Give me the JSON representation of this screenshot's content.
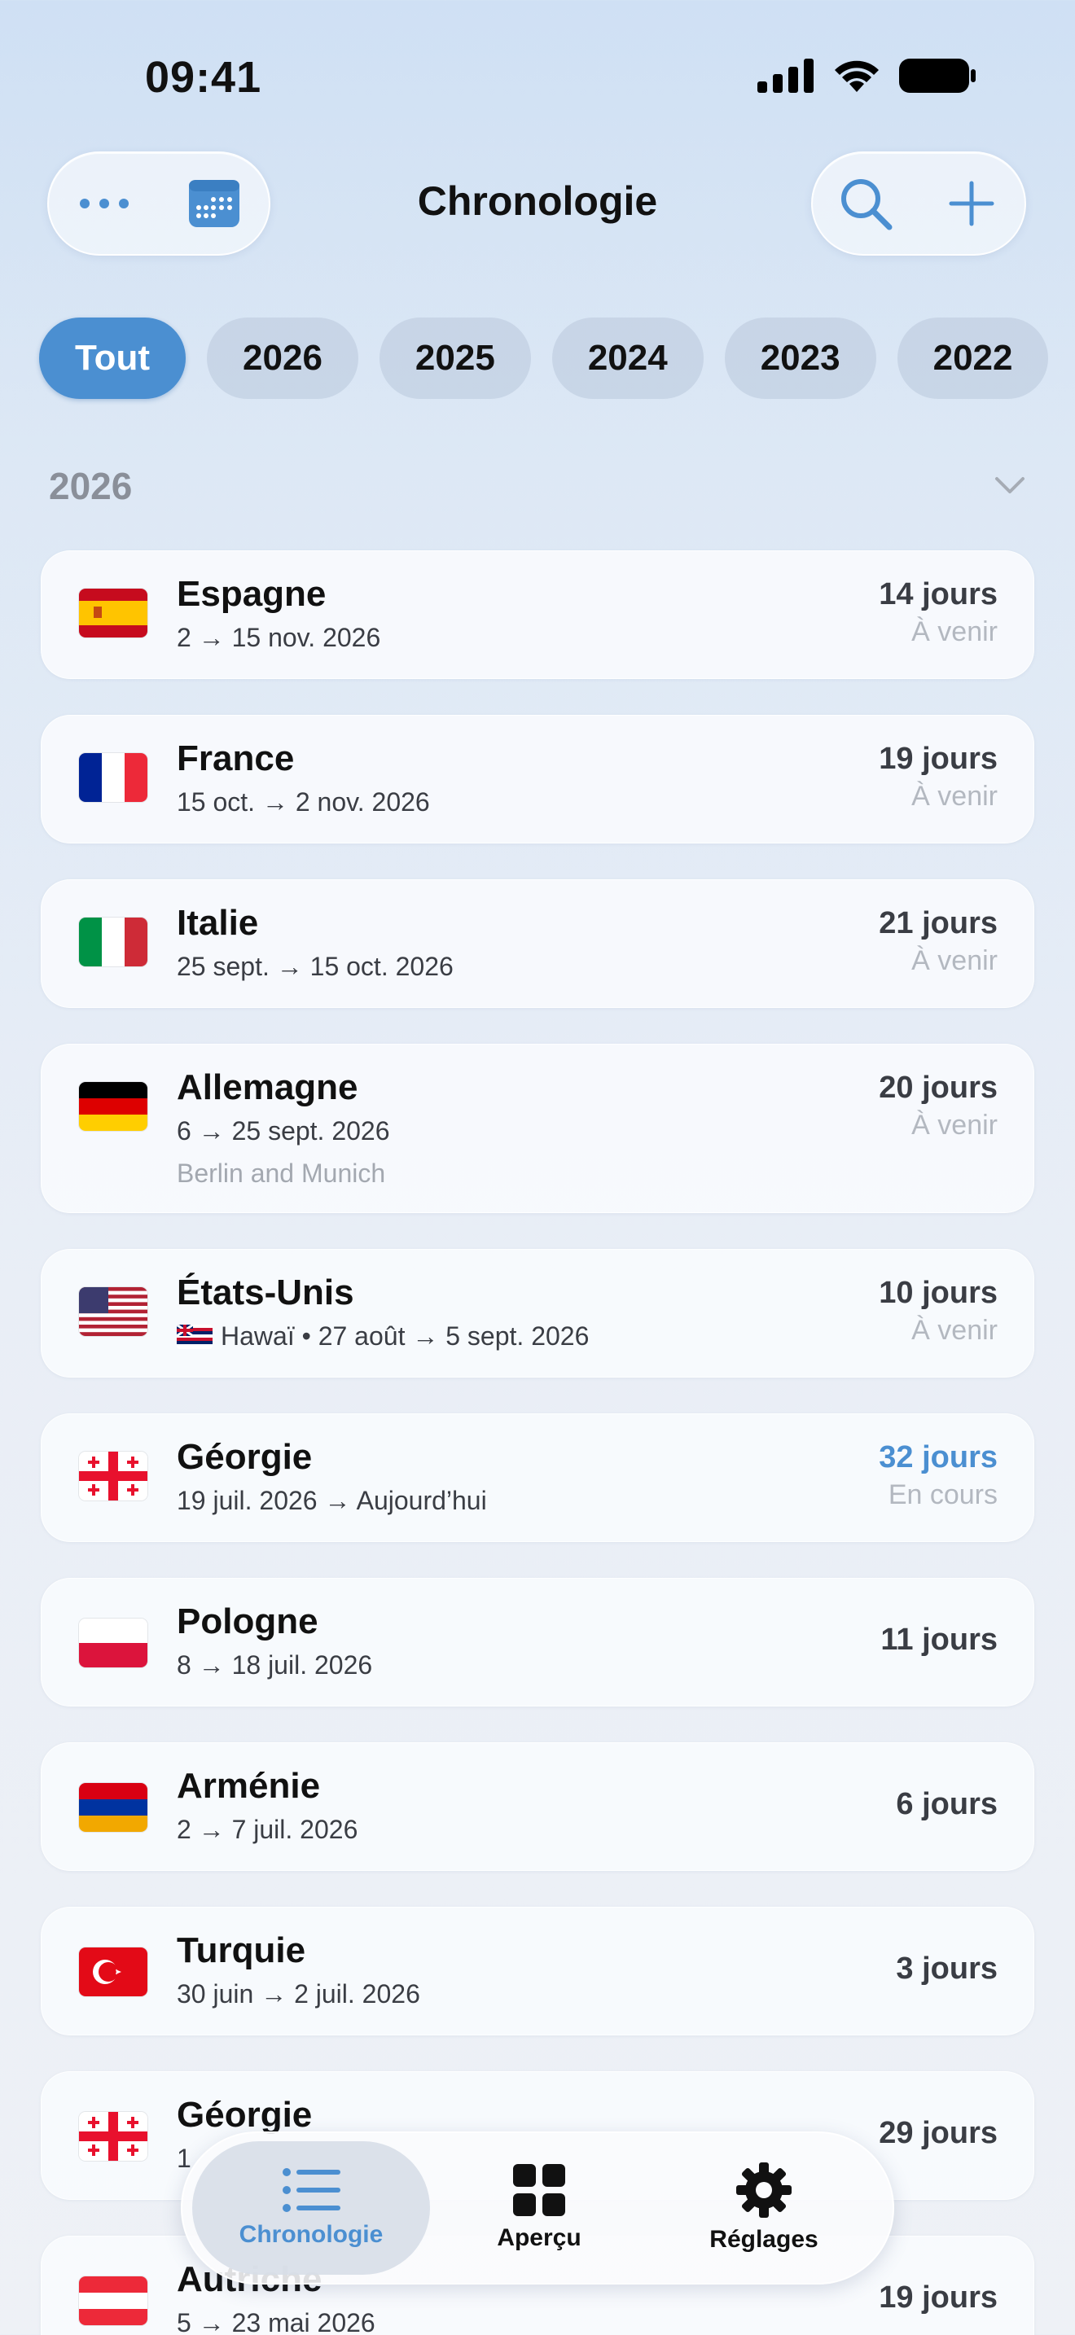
{
  "status_bar": {
    "time": "09:41"
  },
  "header": {
    "title": "Chronologie",
    "more_icon": "ellipsis-icon",
    "calendar_icon": "calendar-icon",
    "search_icon": "search-icon",
    "add_icon": "plus-icon"
  },
  "filters": [
    "Tout",
    "2026",
    "2025",
    "2024",
    "2023",
    "2022"
  ],
  "active_filter": "Tout",
  "section": {
    "title": "2026"
  },
  "trips": [
    {
      "country": "Espagne",
      "dates": "2 → 15 nov. 2026",
      "duration": "14 jours",
      "status": "À venir",
      "flag": "es"
    },
    {
      "country": "France",
      "dates": "15 oct. → 2 nov. 2026",
      "duration": "19 jours",
      "status": "À venir",
      "flag": "fr"
    },
    {
      "country": "Italie",
      "dates": "25 sept. → 15 oct. 2026",
      "duration": "21 jours",
      "status": "À venir",
      "flag": "it"
    },
    {
      "country": "Allemagne",
      "dates": "6 → 25 sept. 2026",
      "note": "Berlin and Munich",
      "duration": "20 jours",
      "status": "À venir",
      "flag": "de"
    },
    {
      "country": "États-Unis",
      "dates": "Hawaï • 27 août → 5 sept. 2026",
      "duration": "10 jours",
      "status": "À venir",
      "flag": "us",
      "sub_flag": "hi"
    },
    {
      "country": "Géorgie",
      "dates": "19 juil. 2026 → Aujourd’hui",
      "duration": "32 jours",
      "status": "En cours",
      "flag": "ge",
      "current": true
    },
    {
      "country": "Pologne",
      "dates": "8 → 18 juil. 2026",
      "duration": "11 jours",
      "flag": "pl"
    },
    {
      "country": "Arménie",
      "dates": "2 → 7 juil. 2026",
      "duration": "6 jours",
      "flag": "am"
    },
    {
      "country": "Turquie",
      "dates": "30 juin → 2 juil. 2026",
      "duration": "3 jours",
      "flag": "tr"
    },
    {
      "country": "Géorgie",
      "dates": "1",
      "duration": "29 jours",
      "flag": "ge"
    },
    {
      "country": "Autriche",
      "dates": "5 → 23 mai 2026",
      "duration": "19 jours",
      "flag": "at"
    }
  ],
  "tab_bar": {
    "tabs": [
      {
        "label": "Chronologie",
        "icon": "list-icon"
      },
      {
        "label": "Aperçu",
        "icon": "grid-icon"
      },
      {
        "label": "Réglages",
        "icon": "gear-icon"
      }
    ],
    "active": "Chronologie"
  },
  "colors": {
    "accent": "#4b8fd1",
    "secondary_text": "#8a8f99"
  }
}
